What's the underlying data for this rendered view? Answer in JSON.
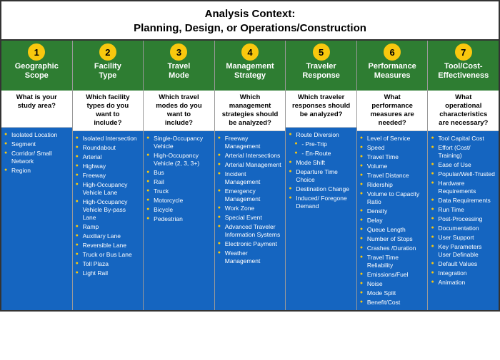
{
  "header": {
    "line1": "Analysis Context:",
    "line2": "Planning, Design, or Operations/Construction"
  },
  "columns": [
    {
      "number": "1",
      "title": "Geographic\nScope",
      "question": "What is your\nstudy area?",
      "items": [
        {
          "text": "Isolated Location",
          "sub": false
        },
        {
          "text": "Segment",
          "sub": false
        },
        {
          "text": "Corridor/\nSmall Network",
          "sub": false
        },
        {
          "text": "Region",
          "sub": false
        }
      ]
    },
    {
      "number": "2",
      "title": "Facility\nType",
      "question": "Which facility\ntypes do you\nwant to\ninclude?",
      "items": [
        {
          "text": "Isolated Intersection",
          "sub": false
        },
        {
          "text": "Roundabout",
          "sub": false
        },
        {
          "text": "Arterial",
          "sub": false
        },
        {
          "text": "Highway",
          "sub": false
        },
        {
          "text": "Freeway",
          "sub": false
        },
        {
          "text": "High-Occupancy Vehicle Lane",
          "sub": false
        },
        {
          "text": "High-Occupancy Vehicle By-pass Lane",
          "sub": false
        },
        {
          "text": "Ramp",
          "sub": false
        },
        {
          "text": "Auxiliary Lane",
          "sub": false
        },
        {
          "text": "Reversible Lane",
          "sub": false
        },
        {
          "text": "Truck or Bus Lane",
          "sub": false
        },
        {
          "text": "Toll Plaza",
          "sub": false
        },
        {
          "text": "Light Rail",
          "sub": false
        }
      ]
    },
    {
      "number": "3",
      "title": "Travel\nMode",
      "question": "Which travel\nmodes do you\nwant to\ninclude?",
      "items": [
        {
          "text": "Single-Occupancy Vehicle",
          "sub": false
        },
        {
          "text": "High-Occupancy Vehicle (2, 3, 3+)",
          "sub": false
        },
        {
          "text": "Bus",
          "sub": false
        },
        {
          "text": "Rail",
          "sub": false
        },
        {
          "text": "Truck",
          "sub": false
        },
        {
          "text": "Motorcycle",
          "sub": false
        },
        {
          "text": "Bicycle",
          "sub": false
        },
        {
          "text": "Pedestrian",
          "sub": false
        }
      ]
    },
    {
      "number": "4",
      "title": "Management\nStrategy",
      "question": "Which\nmanagement\nstrategies should\nbe analyzed?",
      "items": [
        {
          "text": "Freeway Management",
          "sub": false
        },
        {
          "text": "Arterial Intersections",
          "sub": false
        },
        {
          "text": "Arterial Management",
          "sub": false
        },
        {
          "text": "Incident Management",
          "sub": false
        },
        {
          "text": "Emergency Management",
          "sub": false
        },
        {
          "text": "Work Zone",
          "sub": false
        },
        {
          "text": "Special Event",
          "sub": false
        },
        {
          "text": "Advanced Traveler Information Systems",
          "sub": false
        },
        {
          "text": "Electronic Payment",
          "sub": false
        },
        {
          "text": "Weather Management",
          "sub": false
        }
      ]
    },
    {
      "number": "5",
      "title": "Traveler\nResponse",
      "question": "Which traveler\nresponses should\nbe analyzed?",
      "items": [
        {
          "text": "Route Diversion",
          "sub": false
        },
        {
          "text": "- Pre-Trip",
          "sub": true
        },
        {
          "text": "- En-Route",
          "sub": true
        },
        {
          "text": "Mode Shift",
          "sub": false
        },
        {
          "text": "Departure Time Choice",
          "sub": false
        },
        {
          "text": "Destination Change",
          "sub": false
        },
        {
          "text": "Induced/ Foregone Demand",
          "sub": false
        }
      ]
    },
    {
      "number": "6",
      "title": "Performance\nMeasures",
      "question": "What\nperformance\nmeasures are\nneeded?",
      "items": [
        {
          "text": "Level of Service",
          "sub": false
        },
        {
          "text": "Speed",
          "sub": false
        },
        {
          "text": "Travel Time",
          "sub": false
        },
        {
          "text": "Volume",
          "sub": false
        },
        {
          "text": "Travel Distance",
          "sub": false
        },
        {
          "text": "Ridership",
          "sub": false
        },
        {
          "text": "Volume to Capacity Ratio",
          "sub": false
        },
        {
          "text": "Density",
          "sub": false
        },
        {
          "text": "Delay",
          "sub": false
        },
        {
          "text": "Queue Length",
          "sub": false
        },
        {
          "text": "Number of Stops",
          "sub": false
        },
        {
          "text": "Crashes /Duration",
          "sub": false
        },
        {
          "text": "Travel Time Reliability",
          "sub": false
        },
        {
          "text": "Emissions/Fuel",
          "sub": false
        },
        {
          "text": "Noise",
          "sub": false
        },
        {
          "text": "Mode Split",
          "sub": false
        },
        {
          "text": "Benefit/Cost",
          "sub": false
        }
      ]
    },
    {
      "number": "7",
      "title": "Tool/Cost-\nEffectiveness",
      "question": "What\noperational\ncharacteristics\nare necessary?",
      "items": [
        {
          "text": "Tool Capital Cost",
          "sub": false
        },
        {
          "text": "Effort (Cost/ Training)",
          "sub": false
        },
        {
          "text": "Ease of Use",
          "sub": false
        },
        {
          "text": "Popular/Well-Trusted",
          "sub": false
        },
        {
          "text": "Hardware Requirements",
          "sub": false
        },
        {
          "text": "Data Requirements",
          "sub": false
        },
        {
          "text": "Run Time",
          "sub": false
        },
        {
          "text": "Post-Processing",
          "sub": false
        },
        {
          "text": "Documentation",
          "sub": false
        },
        {
          "text": "User Support",
          "sub": false
        },
        {
          "text": "Key Parameters User Definable",
          "sub": false
        },
        {
          "text": "Default Values",
          "sub": false
        },
        {
          "text": "Integration",
          "sub": false
        },
        {
          "text": "Animation",
          "sub": false
        }
      ]
    }
  ]
}
